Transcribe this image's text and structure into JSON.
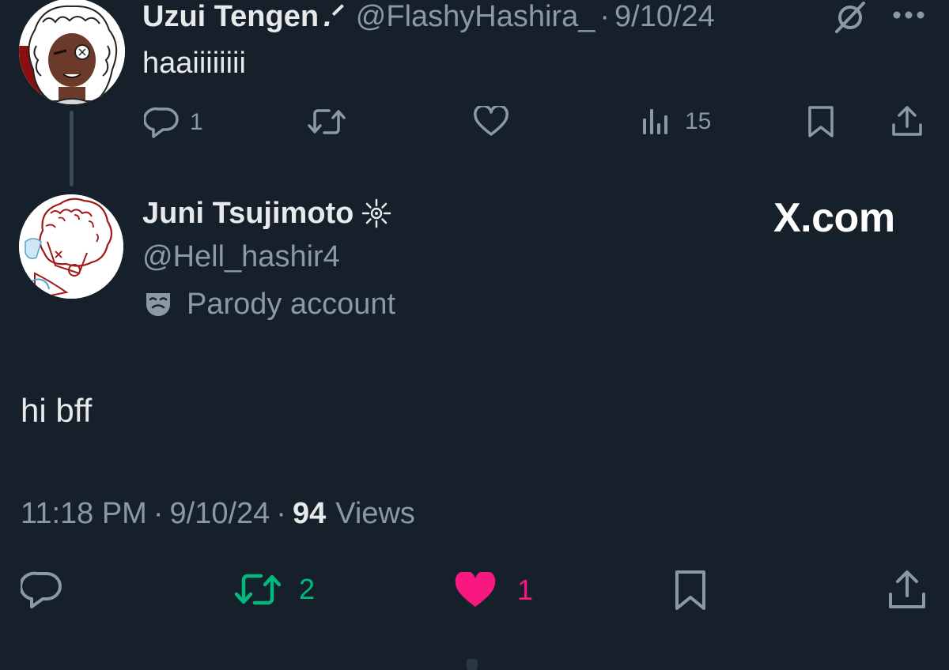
{
  "parent_tweet": {
    "display_name": "Uzui Tengen",
    "name_decoration": ".ᐟ",
    "handle": "@FlashyHashira_",
    "separator": "·",
    "date": "9/10/24",
    "text": "haaiiiiiiii",
    "actions": {
      "reply_count": "1",
      "views_count": "15"
    }
  },
  "main_tweet": {
    "display_name": "Juni Tsujimoto",
    "handle": "@Hell_hashir4",
    "parody_label": "Parody account",
    "watermark": "X.com",
    "text": "hi bff",
    "time": "11:18 PM",
    "separator": "·",
    "date": "9/10/24",
    "views_count": "94",
    "views_label": "Views",
    "actions": {
      "retweet_count": "2",
      "like_count": "1"
    }
  },
  "colors": {
    "background": "#15202b",
    "text_primary": "#e7e9ea",
    "text_secondary": "#8b98a5",
    "retweet_active": "#00ba7c",
    "like_active": "#f91880"
  },
  "icons": [
    "grok-icon",
    "more-icon",
    "reply-icon",
    "retweet-icon",
    "like-icon",
    "views-icon",
    "bookmark-icon",
    "share-icon",
    "sun-verified-icon",
    "parody-mask-icon"
  ]
}
